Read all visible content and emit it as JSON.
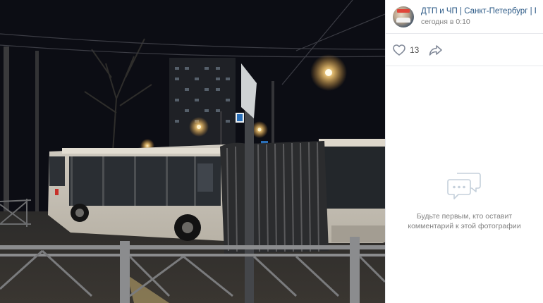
{
  "post": {
    "group_name": "ДТП и ЧП | Санкт-Петербург | Питер онлайн",
    "time": "сегодня в 0:10",
    "likes": "13"
  },
  "comments": {
    "empty_text": "Будьте первым, кто оставит комментарий к этой фотографии"
  },
  "icons": {
    "like": "heart-icon",
    "share": "share-arrow-icon",
    "empty": "chat-bubbles-icon"
  },
  "colors": {
    "link": "#2a5885",
    "meta": "#828282",
    "icon": "#828a99"
  }
}
